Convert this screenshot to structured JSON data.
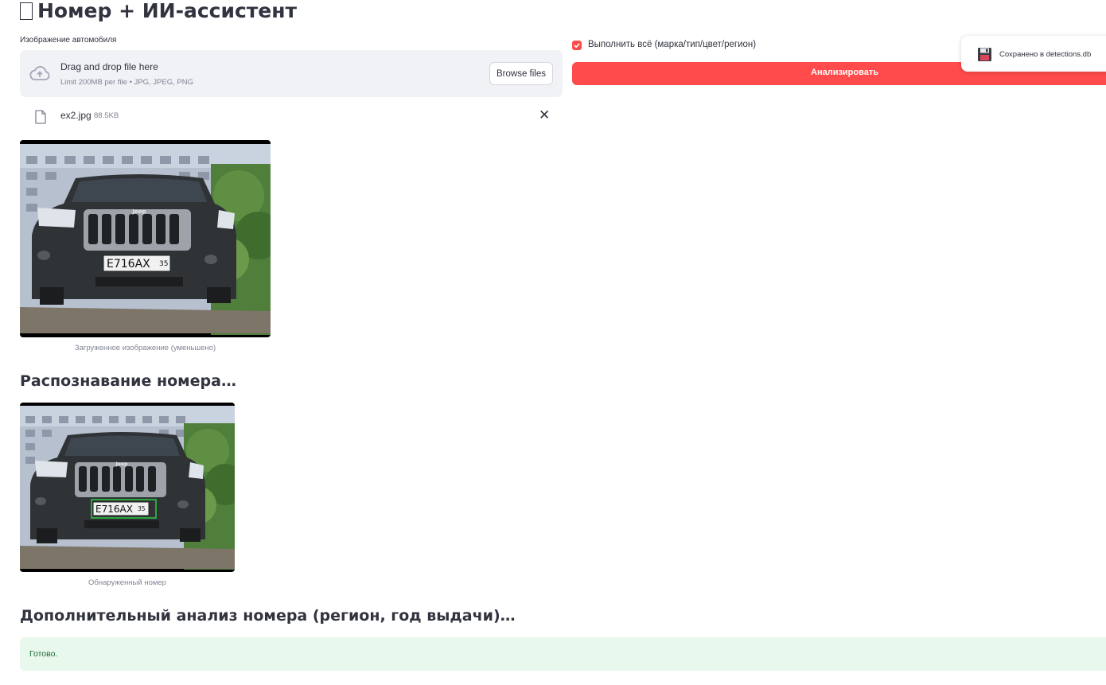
{
  "app": {
    "title": "Номер + ИИ-ассистент",
    "title_icon": "missing-glyph-icon"
  },
  "uploader": {
    "label": "Изображение автомобиля",
    "drop_text": "Drag and drop file here",
    "limit_text": "Limit 200MB per file • JPG, JPEG, PNG",
    "browse_label": "Browse files",
    "file": {
      "name": "ex2.jpg",
      "size": "88.5KB"
    }
  },
  "options": {
    "run_all_label": "Выполнить всё (марка/тип/цвет/регион)",
    "run_all_checked": true,
    "analyze_label": "Анализировать",
    "accent_color": "#ff4b4b"
  },
  "toast": {
    "text": "Сохранено в detections.db",
    "icon": "floppy-disk-icon"
  },
  "uploaded_image": {
    "caption": "Загруженное изображение (уменьшено)",
    "brand_text": "Jeep",
    "plate": {
      "series": "E716AX",
      "region": "35"
    }
  },
  "detection": {
    "heading": "Распознавание номера…",
    "caption": "Обнаруженный номер",
    "box_color": "#2ecc40"
  },
  "analysis": {
    "heading": "Дополнительный анализ номера (регион, год выдачи)…",
    "status": "Готово."
  }
}
